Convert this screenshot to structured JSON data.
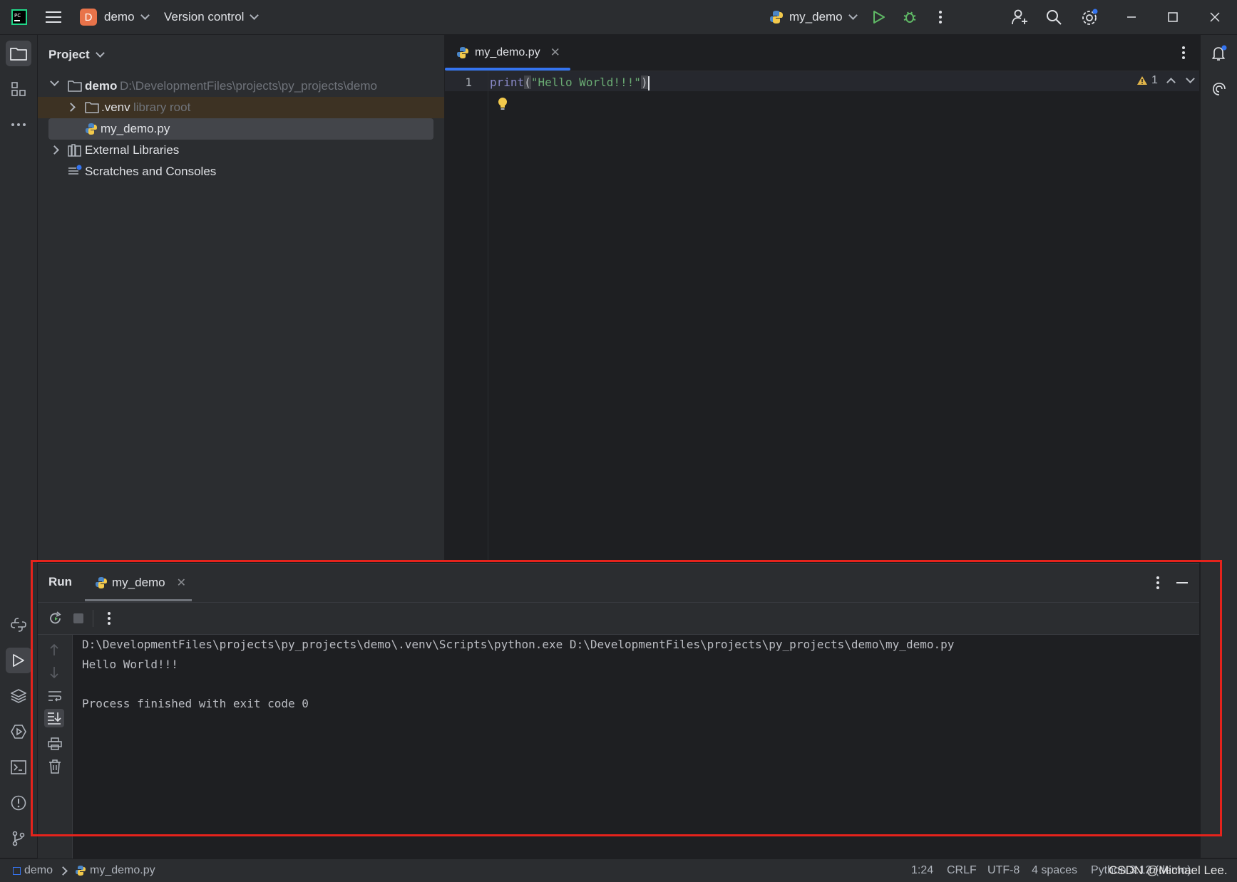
{
  "titlebar": {
    "project_badge": "D",
    "project_name": "demo",
    "vcs_label": "Version control",
    "run_config": "my_demo"
  },
  "project_panel": {
    "title": "Project",
    "tree": [
      {
        "label": "demo",
        "hint": "D:\\DevelopmentFiles\\projects\\py_projects\\demo"
      },
      {
        "label": ".venv",
        "hint": "library root"
      },
      {
        "label": "my_demo.py",
        "hint": ""
      },
      {
        "label": "External Libraries",
        "hint": ""
      },
      {
        "label": "Scratches and Consoles",
        "hint": ""
      }
    ]
  },
  "editor": {
    "tab_label": "my_demo.py",
    "line_number": "1",
    "code_func": "print",
    "code_open": "(",
    "code_string": "\"Hello World!!!\"",
    "code_close": ")",
    "warning_count": "1"
  },
  "run_panel": {
    "title": "Run",
    "tab_label": "my_demo",
    "console": [
      "D:\\DevelopmentFiles\\projects\\py_projects\\demo\\.venv\\Scripts\\python.exe D:\\DevelopmentFiles\\projects\\py_projects\\demo\\my_demo.py",
      "Hello World!!!",
      "",
      "Process finished with exit code 0"
    ]
  },
  "statusbar": {
    "crumb_project": "demo",
    "crumb_file": "my_demo.py",
    "position": "1:24",
    "line_sep": "CRLF",
    "encoding": "UTF-8",
    "indent": "4 spaces",
    "interpreter": "Python 3.12 (demo)",
    "watermark": "CSDN @Michael Lee."
  },
  "colors": {
    "accent": "#3574f0",
    "highlight_box": "#e5231c",
    "badge": "#e8734a",
    "run_green": "#5fb865"
  }
}
